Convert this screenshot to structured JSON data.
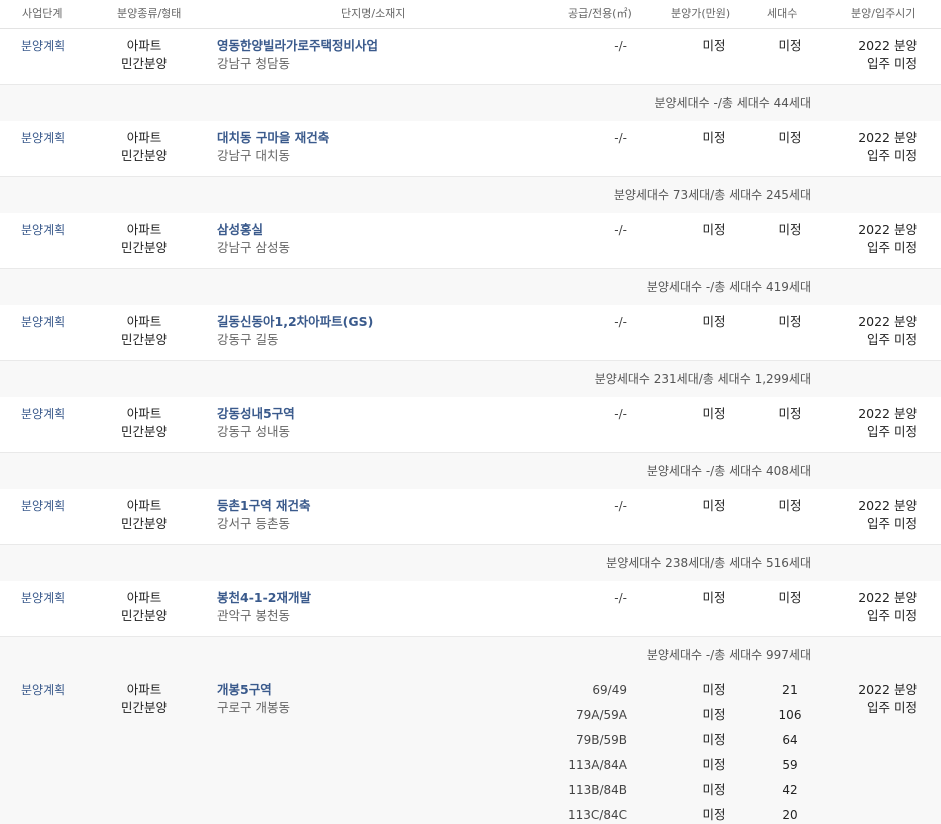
{
  "headers": {
    "stage": "사업단계",
    "type": "분양종류/형태",
    "name": "단지명/소재지",
    "supply": "공급/전용(㎡)",
    "price": "분양가(만원)",
    "units": "세대수",
    "period": "분양/입주시기"
  },
  "listings": [
    {
      "stage": "분양계획",
      "type": "아파트",
      "kind": "민간분양",
      "name": "영동한양빌라가로주택정비사업",
      "location": "강남구 청담동",
      "supply": "-/-",
      "price": "미정",
      "units": "미정",
      "sale": "2022 분양",
      "movein": "입주 미정",
      "summary": "분양세대수 -/총 세대수 44세대"
    },
    {
      "stage": "분양계획",
      "type": "아파트",
      "kind": "민간분양",
      "name": "대치동 구마을 재건축",
      "location": "강남구 대치동",
      "supply": "-/-",
      "price": "미정",
      "units": "미정",
      "sale": "2022 분양",
      "movein": "입주 미정",
      "summary": "분양세대수 73세대/총 세대수 245세대"
    },
    {
      "stage": "분양계획",
      "type": "아파트",
      "kind": "민간분양",
      "name": "삼성홍실",
      "location": "강남구 삼성동",
      "supply": "-/-",
      "price": "미정",
      "units": "미정",
      "sale": "2022 분양",
      "movein": "입주 미정",
      "summary": "분양세대수 -/총 세대수 419세대"
    },
    {
      "stage": "분양계획",
      "type": "아파트",
      "kind": "민간분양",
      "name": "길동신동아1,2차아파트(GS)",
      "location": "강동구 길동",
      "supply": "-/-",
      "price": "미정",
      "units": "미정",
      "sale": "2022 분양",
      "movein": "입주 미정",
      "summary": "분양세대수 231세대/총 세대수 1,299세대"
    },
    {
      "stage": "분양계획",
      "type": "아파트",
      "kind": "민간분양",
      "name": "강동성내5구역",
      "location": "강동구 성내동",
      "supply": "-/-",
      "price": "미정",
      "units": "미정",
      "sale": "2022 분양",
      "movein": "입주 미정",
      "summary": "분양세대수 -/총 세대수 408세대"
    },
    {
      "stage": "분양계획",
      "type": "아파트",
      "kind": "민간분양",
      "name": "등촌1구역 재건축",
      "location": "강서구 등촌동",
      "supply": "-/-",
      "price": "미정",
      "units": "미정",
      "sale": "2022 분양",
      "movein": "입주 미정",
      "summary": "분양세대수 238세대/총 세대수 516세대"
    },
    {
      "stage": "분양계획",
      "type": "아파트",
      "kind": "민간분양",
      "name": "봉천4-1-2재개발",
      "location": "관악구 봉천동",
      "supply": "-/-",
      "price": "미정",
      "units": "미정",
      "sale": "2022 분양",
      "movein": "입주 미정",
      "summary": "분양세대수 -/총 세대수 997세대"
    },
    {
      "stage": "분양계획",
      "type": "아파트",
      "kind": "민간분양",
      "name": "개봉5구역",
      "location": "구로구 개봉동",
      "supply": "69/49",
      "price": "미정",
      "units": "21",
      "sale": "2022 분양",
      "movein": "입주 미정",
      "summary": ""
    }
  ],
  "extra_rows": [
    {
      "supply": "79A/59A",
      "price": "미정",
      "units": "106"
    },
    {
      "supply": "79B/59B",
      "price": "미정",
      "units": "64"
    },
    {
      "supply": "113A/84A",
      "price": "미정",
      "units": "59"
    },
    {
      "supply": "113B/84B",
      "price": "미정",
      "units": "42"
    },
    {
      "supply": "113C/84C",
      "price": "미정",
      "units": "20"
    }
  ]
}
